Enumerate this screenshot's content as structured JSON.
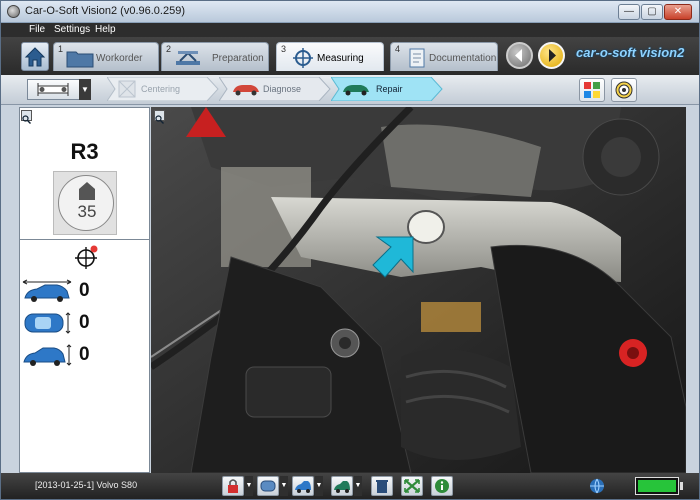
{
  "window": {
    "title": "Car-O-Soft Vision2  (v0.96.0.259)"
  },
  "menu": [
    "File",
    "Settings",
    "Help"
  ],
  "tabs": [
    {
      "num": "1",
      "label": "Workorder"
    },
    {
      "num": "2",
      "label": "Preparation"
    },
    {
      "num": "3",
      "label": "Measuring"
    },
    {
      "num": "4",
      "label": "Documentation"
    }
  ],
  "logo": "car-o-soft vision2",
  "steps": [
    "Centering",
    "Diagnose",
    "Repair"
  ],
  "panel": {
    "point_id": "R3",
    "dial_value": "35",
    "measurements": [
      {
        "axis": "length",
        "value": "0"
      },
      {
        "axis": "width",
        "value": "0"
      },
      {
        "axis": "height",
        "value": "0"
      }
    ]
  },
  "status": {
    "info": "[2013-01-25-1]  Volvo S80"
  },
  "colors": {
    "accent_cyan": "#1fb8d8",
    "active_step": "#9fe3f5",
    "battery": "#27c43a"
  }
}
